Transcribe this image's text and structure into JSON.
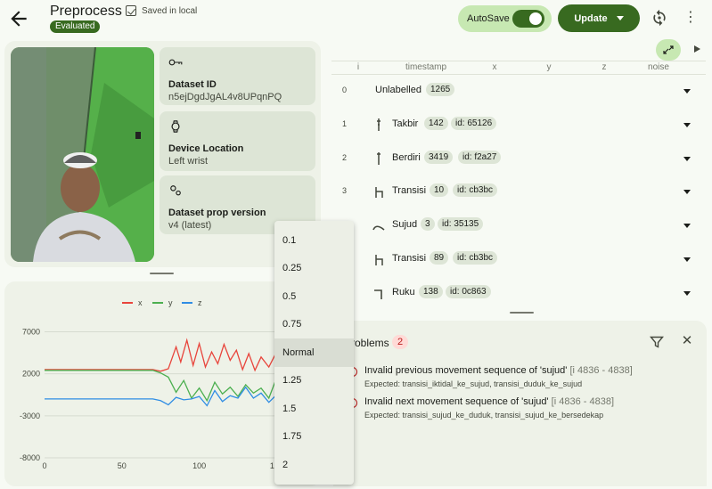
{
  "header": {
    "back_icon": "arrow-left-icon",
    "title": "Preprocess",
    "status_badge": "Evaluated",
    "saved_text": "Saved in local",
    "autosave_label": "AutoSave",
    "autosave_on": true,
    "update_label": "Update"
  },
  "dataset": {
    "id_label": "Dataset ID",
    "id_value": "n5ejDgdJgAL4v8UPqnPQ",
    "location_label": "Device Location",
    "location_value": "Left wrist",
    "version_label": "Dataset prop version",
    "version_value": "v4 (latest)"
  },
  "chart_data": {
    "type": "line",
    "legend": [
      "x",
      "y",
      "z"
    ],
    "colors": {
      "x": "#e8453c",
      "y": "#4caf50",
      "z": "#2f8de4"
    },
    "ylim": [
      -8000,
      8000
    ],
    "yticks": [
      "7000",
      "2000",
      "-3000",
      "-8000"
    ],
    "xticks": [
      "0",
      "50",
      "100",
      "150"
    ],
    "xlim": [
      0,
      175
    ],
    "series": [
      {
        "name": "x",
        "values": [
          [
            0,
            2500
          ],
          [
            70,
            2500
          ],
          [
            75,
            2300
          ],
          [
            80,
            2600
          ],
          [
            85,
            5200
          ],
          [
            88,
            3400
          ],
          [
            92,
            6000
          ],
          [
            96,
            3000
          ],
          [
            100,
            5600
          ],
          [
            104,
            2800
          ],
          [
            108,
            4600
          ],
          [
            112,
            3200
          ],
          [
            116,
            5500
          ],
          [
            120,
            3600
          ],
          [
            124,
            4800
          ],
          [
            128,
            2500
          ],
          [
            132,
            4400
          ],
          [
            136,
            2400
          ],
          [
            140,
            4000
          ],
          [
            145,
            2800
          ],
          [
            150,
            4600
          ],
          [
            155,
            3100
          ],
          [
            160,
            2500
          ],
          [
            165,
            5800
          ],
          [
            170,
            3100
          ],
          [
            175,
            3900
          ]
        ]
      },
      {
        "name": "y",
        "values": [
          [
            0,
            2400
          ],
          [
            70,
            2400
          ],
          [
            75,
            2100
          ],
          [
            80,
            1600
          ],
          [
            85,
            -200
          ],
          [
            90,
            1200
          ],
          [
            95,
            -900
          ],
          [
            100,
            300
          ],
          [
            105,
            -1200
          ],
          [
            110,
            1000
          ],
          [
            115,
            -400
          ],
          [
            120,
            400
          ],
          [
            125,
            -700
          ],
          [
            130,
            700
          ],
          [
            135,
            -300
          ],
          [
            140,
            300
          ],
          [
            145,
            -900
          ],
          [
            150,
            1500
          ],
          [
            155,
            -1500
          ],
          [
            160,
            -300
          ],
          [
            165,
            -2500
          ],
          [
            170,
            400
          ],
          [
            175,
            1800
          ]
        ]
      },
      {
        "name": "z",
        "values": [
          [
            0,
            -1000
          ],
          [
            70,
            -1000
          ],
          [
            75,
            -1200
          ],
          [
            80,
            -1700
          ],
          [
            85,
            -800
          ],
          [
            90,
            -1100
          ],
          [
            95,
            -1000
          ],
          [
            100,
            -700
          ],
          [
            105,
            -1800
          ],
          [
            110,
            0
          ],
          [
            115,
            -1300
          ],
          [
            120,
            -600
          ],
          [
            125,
            -900
          ],
          [
            130,
            400
          ],
          [
            135,
            -900
          ],
          [
            140,
            -300
          ],
          [
            145,
            -1400
          ],
          [
            150,
            -500
          ],
          [
            155,
            -600
          ],
          [
            160,
            -400
          ],
          [
            165,
            -1500
          ],
          [
            170,
            -200
          ],
          [
            175,
            -100
          ]
        ]
      }
    ]
  },
  "table": {
    "columns": [
      "i",
      "timestamp",
      "x",
      "y",
      "z",
      "noise"
    ],
    "rows": [
      {
        "index": "0",
        "label": "Unlabelled",
        "count": "1265",
        "id": ""
      },
      {
        "index": "1",
        "label": "Takbir",
        "count": "142",
        "id": "id: 65126"
      },
      {
        "index": "2",
        "label": "Berdiri",
        "count": "3419",
        "id": "id: f2a27"
      },
      {
        "index": "3",
        "label": "Transisi",
        "count": "10",
        "id": "id: cb3bc"
      },
      {
        "index": "",
        "label": "Sujud",
        "count": "3",
        "id": "id: 35135"
      },
      {
        "index": "",
        "label": "Transisi",
        "count": "89",
        "id": "id: cb3bc"
      },
      {
        "index": "",
        "label": "Ruku",
        "count": "138",
        "id": "id: 0c863"
      }
    ]
  },
  "problems": {
    "title": "roblems",
    "count": "2",
    "items": [
      {
        "message": "Invalid previous movement sequence of 'sujud'",
        "range": "[i 4836 - 4838]",
        "expected": "Expected: transisi_iktidal_ke_sujud, transisi_duduk_ke_sujud"
      },
      {
        "message": "Invalid next movement sequence of 'sujud'",
        "range": "[i 4836 - 4838]",
        "expected": "Expected: transisi_sujud_ke_duduk, transisi_sujud_ke_bersedekap"
      }
    ]
  },
  "speed_menu": {
    "items": [
      "0.1",
      "0.25",
      "0.5",
      "0.75",
      "Normal",
      "1.25",
      "1.5",
      "1.75",
      "2"
    ],
    "selected": "Normal"
  }
}
